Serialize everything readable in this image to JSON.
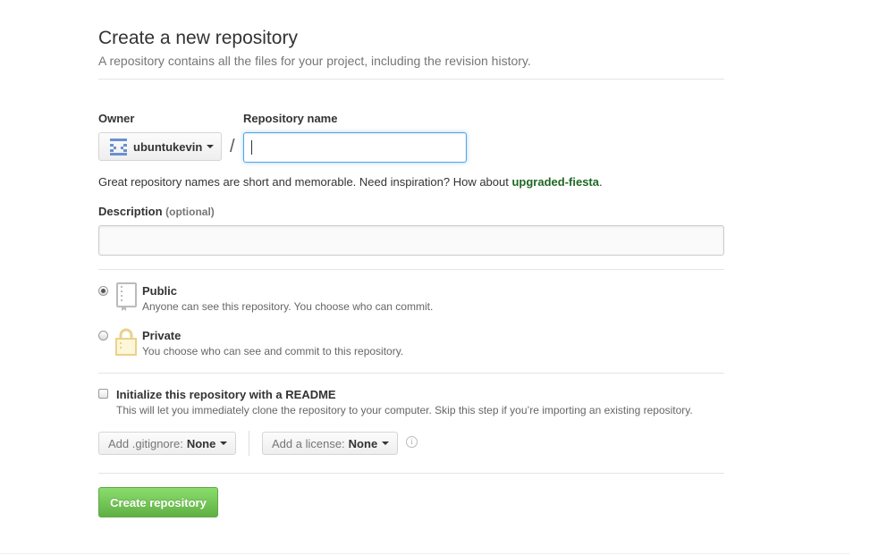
{
  "page": {
    "title": "Create a new repository",
    "subtitle": "A repository contains all the files for your project, including the revision history."
  },
  "owner": {
    "label": "Owner",
    "value": "ubuntukevin"
  },
  "separator": "/",
  "repo_name": {
    "label": "Repository name",
    "value": "",
    "placeholder": ""
  },
  "hint": {
    "prefix": "Great repository names are short and memorable. Need inspiration? How about ",
    "suggestion": "upgraded-fiesta",
    "suffix": "."
  },
  "description": {
    "label": "Description",
    "optional": "(optional)",
    "value": ""
  },
  "visibility": {
    "selected": "public",
    "public": {
      "title": "Public",
      "desc": "Anyone can see this repository. You choose who can commit."
    },
    "private": {
      "title": "Private",
      "desc": "You choose who can see and commit to this repository."
    }
  },
  "readme": {
    "checked": false,
    "title": "Initialize this repository with a README",
    "desc": "This will let you immediately clone the repository to your computer. Skip this step if you’re importing an existing repository."
  },
  "gitignore": {
    "label": "Add .gitignore:",
    "value": "None"
  },
  "license": {
    "label": "Add a license:",
    "value": "None"
  },
  "info_icon": "info-icon",
  "submit": {
    "label": "Create repository"
  },
  "colors": {
    "accent_green": "#60b044",
    "suggestion_green": "#1e6823",
    "focus_blue": "#51a7e8"
  }
}
